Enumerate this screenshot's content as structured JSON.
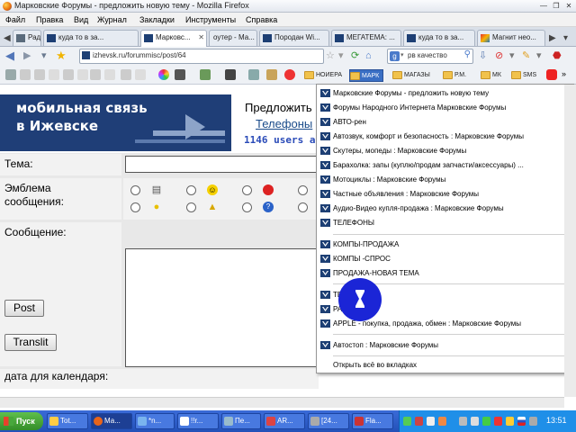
{
  "window": {
    "title": "Марковские Форумы - предложить новую тему - Mozilla Firefox",
    "buttons": [
      "—",
      "❐",
      "✕"
    ]
  },
  "menubar": {
    "items": [
      "Файл",
      "Правка",
      "Вид",
      "Журнал",
      "Закладки",
      "Инструменты",
      "Справка"
    ]
  },
  "tabs": [
    {
      "label": "Рад...",
      "icon": "page-icon"
    },
    {
      "label": "куда то в за...",
      "icon": "forum-icon"
    },
    {
      "label": "Марковс...",
      "icon": "forum-icon",
      "active": true
    },
    {
      "label": "оутер - Ма...",
      "icon": "forum-icon"
    },
    {
      "label": "Породан Wi...",
      "icon": "forum-icon"
    },
    {
      "label": "МЕГАТЕМА: ...",
      "icon": "forum-icon"
    },
    {
      "label": "куда то в за...",
      "icon": "forum-icon"
    },
    {
      "label": "Магнит нео...",
      "icon": "magnit-icon"
    }
  ],
  "navbar": {
    "url": "izhevsk.ru/forummisc/post/64",
    "search_value": "рв качество"
  },
  "bookmarks": [
    {
      "label": "НОИЕРА"
    },
    {
      "label": "МАРК",
      "open": true
    },
    {
      "label": "МАГАЗЫ"
    },
    {
      "label": "Р.М."
    },
    {
      "label": "МК"
    },
    {
      "label": "SMS"
    }
  ],
  "page": {
    "banner_line1": "мобильная связь",
    "banner_line2": "в Ижевске",
    "heading": "Предложить",
    "phones_link": "Телефоны",
    "users_online": "1146 users a",
    "label_topic": "Тема:",
    "label_emblem": "Эмблема сообщения:",
    "label_message": "Сообщение:",
    "label_date": "дата для календаря:",
    "post_button": "Post",
    "translit_button": "Translit"
  },
  "dropdown": {
    "items": [
      "Марковские Форумы - предложить новую тему",
      "Форумы Народного Интернета Марковские Форумы",
      "АВТО-рен",
      "Автозвук, комфорт и безопасность : Марковские Форумы",
      "Скутеры, мопеды : Марковские Форумы",
      "Барахолка: запы (куплю/продам запчасти/аксессуары) ...",
      "Мотоциклы : Марковские Форумы",
      "Частные объявления : Марковские Форумы",
      "Аудио-Видео купля-продажа : Марковские Форумы",
      "ТЕЛЕФОНЫ",
      "КОМПЫ-ПРОДАЖА",
      "КОМПЫ -СПРОС",
      "ПРОДАЖА-НОВАЯ ТЕМА",
      "ТЕ...",
      "РАЗ...",
      "APPLE - покупка, продажа, обмен : Марковские Форумы",
      "Автостоп : Марковские Форумы"
    ],
    "open_all": "Открыть всё во вкладках"
  },
  "taskbar": {
    "start": "Пуск",
    "tasks": [
      "Tot...",
      "Ма...",
      "*n...",
      "!!r...",
      "Пе...",
      "AR...",
      "[24...",
      "Fla..."
    ],
    "clock": "13:51"
  },
  "colors": {
    "forum_icon": "#1d3f74",
    "banner_bg": "#1f3e77",
    "taskbar": "#2350b8",
    "cursor": "#1b25d6",
    "bookmark_open": "#3a6fc4"
  }
}
